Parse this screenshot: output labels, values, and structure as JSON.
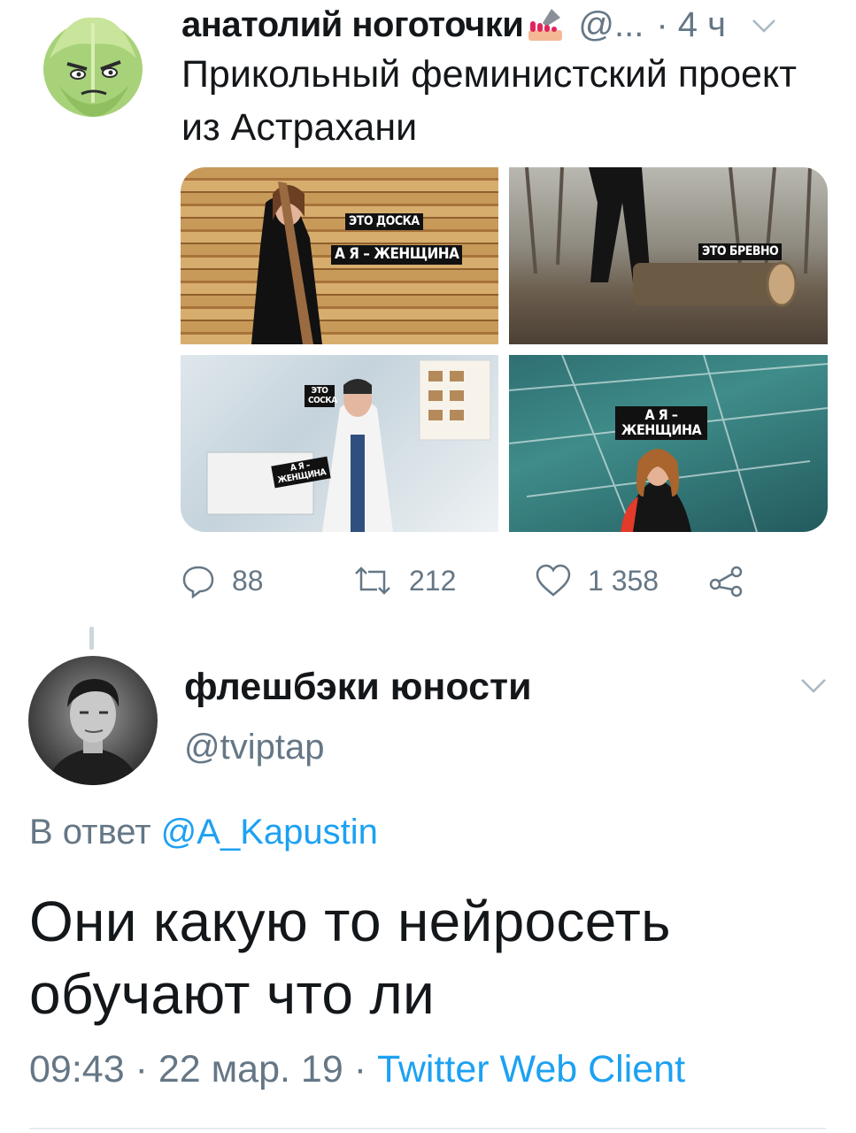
{
  "tweet1": {
    "author_name": "анатолий ноготочки",
    "handle": "@...",
    "time": "· 4 ч",
    "text": "Прикольный феминистский проект из Астрахани",
    "images": [
      {
        "captions": [
          "ЭТО ДОСКА",
          "А Я – ЖЕНЩИНА"
        ]
      },
      {
        "captions": [
          "ЭТО БРЕВНО"
        ]
      },
      {
        "captions": [
          "ЭТО СОСКА",
          "А Я – ЖЕНЩИНА"
        ]
      },
      {
        "captions": [
          "А Я – ЖЕНЩИНА"
        ]
      }
    ],
    "actions": {
      "replies": "88",
      "retweets": "212",
      "likes": "1 358"
    }
  },
  "tweet2": {
    "author_name": "флешбэки юности",
    "handle": "@tviptap",
    "reply_prefix": "В ответ",
    "reply_mention": "@A_Kapustin",
    "text": "Они какую то нейросеть обучают что ли",
    "time": "09:43",
    "date": "22 мар. 19",
    "separator": "·",
    "client": "Twitter Web Client"
  },
  "icons": {
    "reply": "reply-icon",
    "retweet": "retweet-icon",
    "like": "heart-icon",
    "share": "share-icon",
    "more": "chevron-down-icon"
  },
  "colors": {
    "text": "#14171a",
    "secondary": "#657786",
    "link": "#1da1f2"
  }
}
